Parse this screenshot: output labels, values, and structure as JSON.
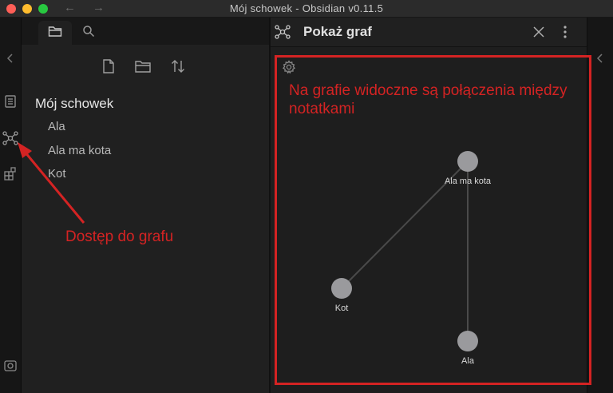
{
  "window": {
    "title": "Mój schowek - Obsidian v0.11.5"
  },
  "ribbon": {
    "icons": [
      "panel-icon",
      "graph-icon",
      "templates-icon",
      "vault-settings-icon"
    ]
  },
  "file_explorer": {
    "tabs": [
      "folder-icon",
      "search-icon"
    ],
    "actions": [
      "new-note-icon",
      "new-folder-icon",
      "sort-icon"
    ],
    "vault_name": "Mój schowek",
    "files": [
      "Ala",
      "Ala ma kota",
      "Kot"
    ]
  },
  "graph_view": {
    "title": "Pokaż graf",
    "nodes": [
      {
        "label": "Ala ma kota"
      },
      {
        "label": "Kot"
      },
      {
        "label": "Ala"
      }
    ],
    "links": [
      [
        "Ala ma kota",
        "Kot"
      ],
      [
        "Ala ma kota",
        "Ala"
      ]
    ]
  },
  "annotations": {
    "graph_note": "Na grafie widoczne są połączenia między notatkami",
    "access_note": "Dostęp do grafu",
    "color": "#d42323"
  }
}
